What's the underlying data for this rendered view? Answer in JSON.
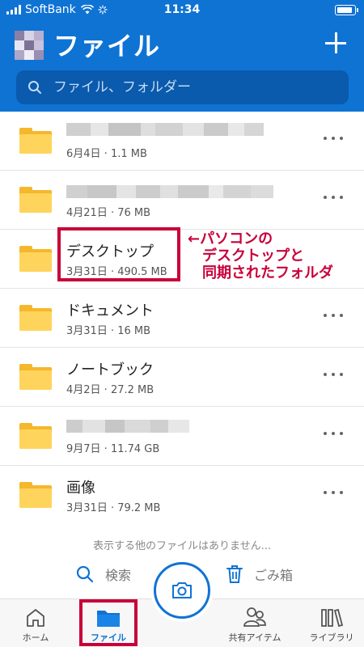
{
  "status_bar": {
    "carrier": "SoftBank",
    "time": "11:34"
  },
  "header": {
    "title": "ファイル",
    "search_placeholder": "ファイル、フォルダー",
    "accent_color": "#0f73d4"
  },
  "files": [
    {
      "name": "",
      "meta": "6月4日 · 1.1 MB",
      "obscured": true
    },
    {
      "name": "",
      "meta": "4月21日 · 76 MB",
      "obscured": true
    },
    {
      "name": "デスクトップ",
      "meta": "3月31日 · 490.5 MB",
      "obscured": false
    },
    {
      "name": "ドキュメント",
      "meta": "3月31日 · 16 MB",
      "obscured": false
    },
    {
      "name": "ノートブック",
      "meta": "4月2日 · 27.2 MB",
      "obscured": false
    },
    {
      "name": "",
      "meta": "9月7日 · 11.74 GB",
      "obscured": true
    },
    {
      "name": "画像",
      "meta": "3月31日 · 79.2 MB",
      "obscured": false
    }
  ],
  "annotation": {
    "lines": [
      "←パソコンの",
      "デスクトップと",
      "同期されたフォルダ"
    ],
    "color": "#c8003a"
  },
  "no_more_text": "表示する他のファイルはありません...",
  "actions": {
    "search_label": "検索",
    "trash_label": "ごみ箱"
  },
  "bottom_nav": {
    "home": "ホーム",
    "files": "ファイル",
    "shared": "共有アイテム",
    "library": "ライブラリ"
  },
  "icons": [
    "search-icon",
    "folder-icon",
    "more-icon",
    "trash-icon",
    "home-icon",
    "camera-icon",
    "people-icon",
    "library-icon",
    "add-icon"
  ]
}
